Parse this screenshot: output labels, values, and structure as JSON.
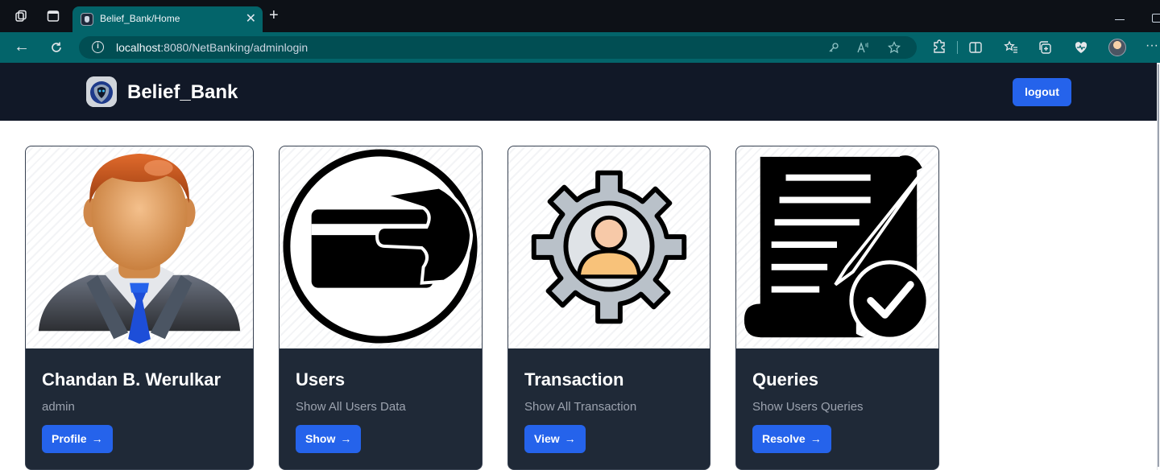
{
  "browser": {
    "tab_title": "Belief_Bank/Home",
    "tab_close": "✕",
    "new_tab": "+",
    "url_host": "localhost",
    "url_path": ":8080/NetBanking/adminlogin",
    "back": "←",
    "refresh": "C",
    "menu": "···"
  },
  "header": {
    "brand": "Belief_Bank",
    "logout_label": "logout"
  },
  "cards": [
    {
      "title": "Chandan B. Werulkar",
      "subtitle": "admin",
      "button": "Profile",
      "icon": "admin-avatar-icon"
    },
    {
      "title": "Users",
      "subtitle": "Show All Users Data",
      "button": "Show",
      "icon": "credit-card-hand-icon"
    },
    {
      "title": "Transaction",
      "subtitle": "Show All Transaction",
      "button": "View",
      "icon": "user-gear-icon"
    },
    {
      "title": "Queries",
      "subtitle": "Show Users Queries",
      "button": "Resolve",
      "icon": "document-check-icon"
    }
  ],
  "arrow_glyph": "→",
  "colors": {
    "header_bg": "#111827",
    "card_body": "#1f2937",
    "button_blue": "#2563eb",
    "chrome_teal": "#03646a"
  }
}
